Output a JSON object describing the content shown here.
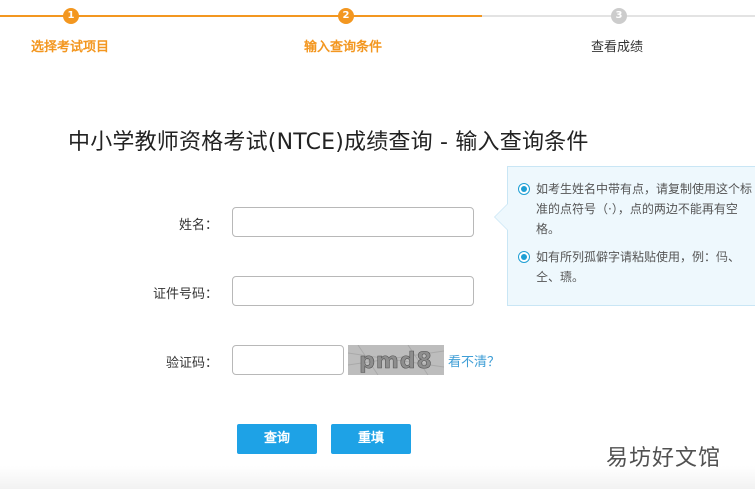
{
  "steps": [
    {
      "number": "1",
      "label": "选择考试项目",
      "status": "done"
    },
    {
      "number": "2",
      "label": "输入查询条件",
      "status": "current"
    },
    {
      "number": "3",
      "label": "查看成绩",
      "status": "todo"
    }
  ],
  "title": "中小学教师资格考试(NTCE)成绩查询 - 输入查询条件",
  "form": {
    "name_label": "姓名：",
    "name_value": "",
    "id_label": "证件号码：",
    "id_value": "",
    "captcha_label": "验证码：",
    "captcha_value": "",
    "captcha_image_text": "pmd8",
    "captcha_refresh": "看不清？"
  },
  "buttons": {
    "query": "查询",
    "reset": "重填"
  },
  "tips": [
    "如考生姓名中带有点，请复制使用这个标准的点符号（·），点的两边不能再有空格。",
    "如有所列孤僻字请粘贴使用，例：㐷、仝、瓙。"
  ],
  "watermark": "易坊好文馆",
  "colors": {
    "accent_orange": "#f39720",
    "button_blue": "#1ea2e6",
    "link_blue": "#3f9ed6",
    "tip_background": "#eef8fd"
  }
}
